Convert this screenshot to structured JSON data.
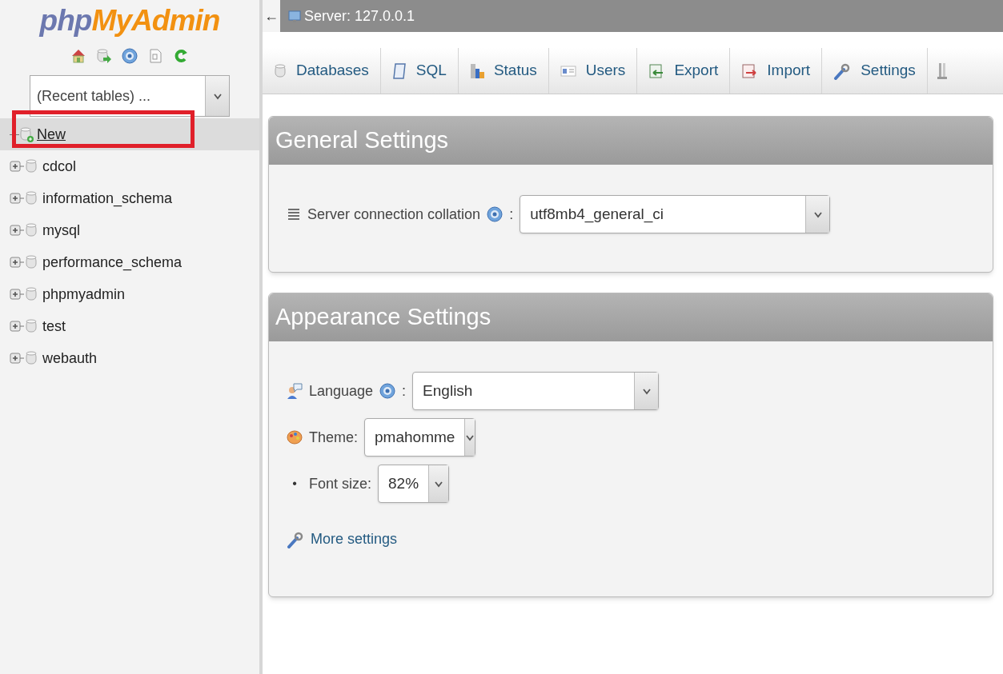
{
  "sidebar": {
    "logo": {
      "part_1": "php",
      "part_2": "MyAdmin"
    },
    "recent_tables": {
      "value": "(Recent tables) ..."
    },
    "tree": [
      {
        "kind": "new",
        "label": "New",
        "highlighted": true
      },
      {
        "kind": "database",
        "label": "cdcol",
        "highlighted": false
      },
      {
        "kind": "database",
        "label": "information_schema",
        "highlighted": false
      },
      {
        "kind": "database",
        "label": "mysql",
        "highlighted": false
      },
      {
        "kind": "database",
        "label": "performance_schema",
        "highlighted": false
      },
      {
        "kind": "database",
        "label": "phpmyadmin",
        "highlighted": false
      },
      {
        "kind": "database",
        "label": "test",
        "highlighted": false
      },
      {
        "kind": "database",
        "label": "webauth",
        "highlighted": false
      }
    ]
  },
  "breadcrumb": {
    "back": "←",
    "server": "Server: 127.0.0.1"
  },
  "tabs": [
    {
      "label": "Databases"
    },
    {
      "label": "SQL"
    },
    {
      "label": "Status"
    },
    {
      "label": "Users"
    },
    {
      "label": "Export"
    },
    {
      "label": "Import"
    },
    {
      "label": "Settings"
    }
  ],
  "panels": [
    {
      "title": "General Settings",
      "rows": [
        {
          "kind": "select",
          "label": "Server connection collation",
          "help": true,
          "colon": ":",
          "value": "utf8mb4_general_ci"
        }
      ]
    },
    {
      "title": "Appearance Settings",
      "rows": [
        {
          "kind": "select",
          "label": "Language",
          "help": true,
          "colon": ":",
          "value": "English"
        },
        {
          "kind": "select",
          "label": "Theme:",
          "help": false,
          "value": "pmahomme"
        },
        {
          "kind": "select",
          "bullet": "•",
          "label": "Font size:",
          "help": false,
          "value": "82%"
        },
        {
          "kind": "link",
          "label": "More settings"
        }
      ]
    }
  ]
}
